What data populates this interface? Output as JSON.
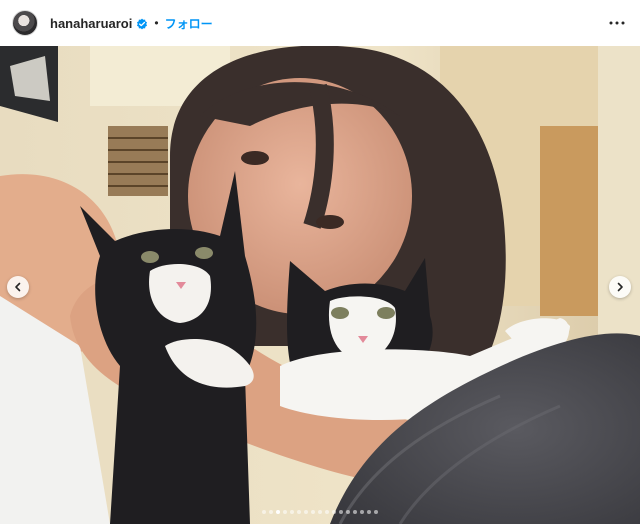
{
  "post_header": {
    "username": "hanaharuaroi",
    "separator": "•",
    "follow_label": "フォロー",
    "verified_icon": "verified-badge-icon",
    "more_icon": "more-options-icon"
  },
  "carousel": {
    "slide_count": 17,
    "active_index": 2,
    "prev_icon": "chevron-left-icon",
    "next_icon": "chevron-right-icon"
  },
  "colors": {
    "follow_blue": "#0095f6",
    "verified_blue": "#0095f6",
    "text_dark": "#262626"
  }
}
